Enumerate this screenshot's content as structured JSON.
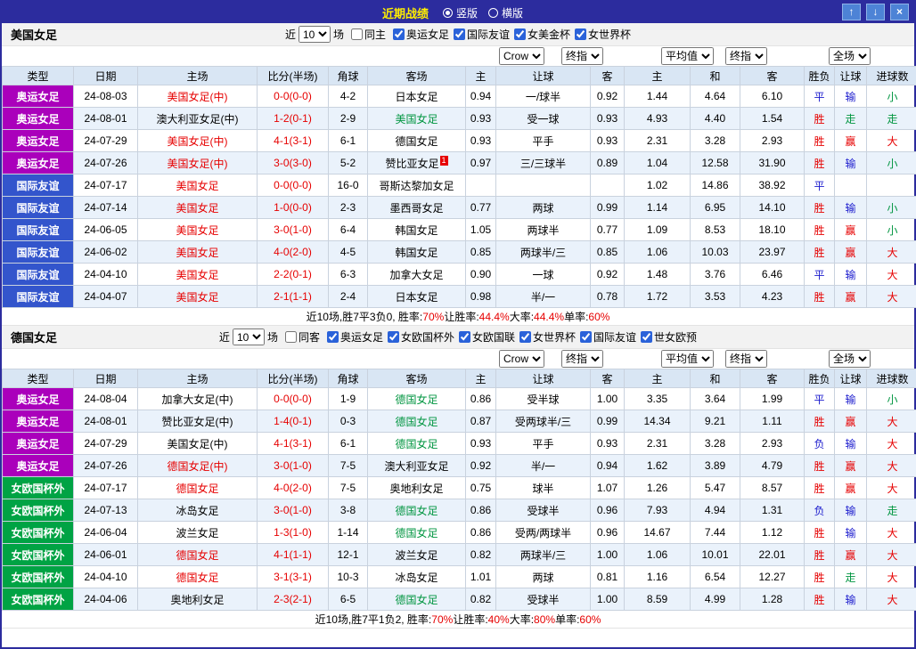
{
  "titlebar": {
    "title": "近期战绩",
    "radios": [
      {
        "label": "竖版",
        "selected": true
      },
      {
        "label": "横版",
        "selected": false
      }
    ],
    "buttons": [
      {
        "name": "scroll-up",
        "glyph": "↑"
      },
      {
        "name": "scroll-down",
        "glyph": "↓"
      },
      {
        "name": "close",
        "glyph": "×"
      }
    ]
  },
  "columns": [
    "类型",
    "日期",
    "主场",
    "比分(半场)",
    "角球",
    "客场",
    "主",
    "让球",
    "客",
    "主",
    "和",
    "客",
    "胜负",
    "让球",
    "进球数"
  ],
  "header_selects": [
    "Crow",
    "终指",
    "平均值",
    "终指",
    "全场"
  ],
  "colors": {
    "topbar": "#2c2c9e",
    "title": "#ffee00",
    "header_bg": "#d9e6f4",
    "alt_row_bg": "#eaf2fb",
    "type_olympic": "#aa00bb",
    "type_friendly": "#3355cc",
    "type_euroq": "#00a344",
    "red": "#e60000",
    "green": "#009540",
    "blue": "#1a1acd"
  },
  "sections": [
    {
      "team": "美国女足",
      "filters": {
        "near": "近",
        "count": "10",
        "games": "场",
        "same": {
          "label": "同主",
          "checked": false
        },
        "leagues": [
          {
            "label": "奥运女足",
            "checked": true
          },
          {
            "label": "国际友谊",
            "checked": true
          },
          {
            "label": "女美金杯",
            "checked": true
          },
          {
            "label": "女世界杯",
            "checked": true
          }
        ]
      },
      "rows": [
        {
          "league": "奥运女足",
          "lc": "olympic",
          "date": "24-08-03",
          "home": "美国女足(中)",
          "homec": "red",
          "score": "0-0(0-0)",
          "corner": "4-2",
          "away": "日本女足",
          "awayc": "black",
          "badge": "",
          "wo": "0.94",
          "line": "一/球半",
          "lo": "0.92",
          "ah": "1.44",
          "ad": "4.64",
          "aa": "6.10",
          "wdl": "平",
          "wdlc": "blue",
          "hr": "输",
          "hrc": "blue",
          "gr": "小",
          "grc": "green"
        },
        {
          "league": "奥运女足",
          "lc": "olympic",
          "date": "24-08-01",
          "home": "澳大利亚女足(中)",
          "homec": "black",
          "score": "1-2(0-1)",
          "corner": "2-9",
          "away": "美国女足",
          "awayc": "green",
          "badge": "",
          "wo": "0.93",
          "line": "受一球",
          "lo": "0.93",
          "ah": "4.93",
          "ad": "4.40",
          "aa": "1.54",
          "wdl": "胜",
          "wdlc": "red",
          "hr": "走",
          "hrc": "green",
          "gr": "走",
          "grc": "green"
        },
        {
          "league": "奥运女足",
          "lc": "olympic",
          "date": "24-07-29",
          "home": "美国女足(中)",
          "homec": "red",
          "score": "4-1(3-1)",
          "corner": "6-1",
          "away": "德国女足",
          "awayc": "black",
          "badge": "",
          "wo": "0.93",
          "line": "平手",
          "lo": "0.93",
          "ah": "2.31",
          "ad": "3.28",
          "aa": "2.93",
          "wdl": "胜",
          "wdlc": "red",
          "hr": "赢",
          "hrc": "red",
          "gr": "大",
          "grc": "red"
        },
        {
          "league": "奥运女足",
          "lc": "olympic",
          "date": "24-07-26",
          "home": "美国女足(中)",
          "homec": "red",
          "score": "3-0(3-0)",
          "corner": "5-2",
          "away": "赞比亚女足",
          "awayc": "black",
          "badge": "1",
          "wo": "0.97",
          "line": "三/三球半",
          "lo": "0.89",
          "ah": "1.04",
          "ad": "12.58",
          "aa": "31.90",
          "wdl": "胜",
          "wdlc": "red",
          "hr": "输",
          "hrc": "blue",
          "gr": "小",
          "grc": "green"
        },
        {
          "league": "国际友谊",
          "lc": "friendly",
          "date": "24-07-17",
          "home": "美国女足",
          "homec": "red",
          "score": "0-0(0-0)",
          "corner": "16-0",
          "away": "哥斯达黎加女足",
          "awayc": "black",
          "badge": "",
          "wo": "",
          "line": "",
          "lo": "",
          "ah": "1.02",
          "ad": "14.86",
          "aa": "38.92",
          "wdl": "平",
          "wdlc": "blue",
          "hr": "",
          "hrc": "black",
          "gr": "",
          "grc": "black"
        },
        {
          "league": "国际友谊",
          "lc": "friendly",
          "date": "24-07-14",
          "home": "美国女足",
          "homec": "red",
          "score": "1-0(0-0)",
          "corner": "2-3",
          "away": "墨西哥女足",
          "awayc": "black",
          "badge": "",
          "wo": "0.77",
          "line": "两球",
          "lo": "0.99",
          "ah": "1.14",
          "ad": "6.95",
          "aa": "14.10",
          "wdl": "胜",
          "wdlc": "red",
          "hr": "输",
          "hrc": "blue",
          "gr": "小",
          "grc": "green"
        },
        {
          "league": "国际友谊",
          "lc": "friendly",
          "date": "24-06-05",
          "home": "美国女足",
          "homec": "red",
          "score": "3-0(1-0)",
          "corner": "6-4",
          "away": "韩国女足",
          "awayc": "black",
          "badge": "",
          "wo": "1.05",
          "line": "两球半",
          "lo": "0.77",
          "ah": "1.09",
          "ad": "8.53",
          "aa": "18.10",
          "wdl": "胜",
          "wdlc": "red",
          "hr": "赢",
          "hrc": "red",
          "gr": "小",
          "grc": "green"
        },
        {
          "league": "国际友谊",
          "lc": "friendly",
          "date": "24-06-02",
          "home": "美国女足",
          "homec": "red",
          "score": "4-0(2-0)",
          "corner": "4-5",
          "away": "韩国女足",
          "awayc": "black",
          "badge": "",
          "wo": "0.85",
          "line": "两球半/三",
          "lo": "0.85",
          "ah": "1.06",
          "ad": "10.03",
          "aa": "23.97",
          "wdl": "胜",
          "wdlc": "red",
          "hr": "赢",
          "hrc": "red",
          "gr": "大",
          "grc": "red"
        },
        {
          "league": "国际友谊",
          "lc": "friendly",
          "date": "24-04-10",
          "home": "美国女足",
          "homec": "red",
          "score": "2-2(0-1)",
          "corner": "6-3",
          "away": "加拿大女足",
          "awayc": "black",
          "badge": "",
          "wo": "0.90",
          "line": "一球",
          "lo": "0.92",
          "ah": "1.48",
          "ad": "3.76",
          "aa": "6.46",
          "wdl": "平",
          "wdlc": "blue",
          "hr": "输",
          "hrc": "blue",
          "gr": "大",
          "grc": "red"
        },
        {
          "league": "国际友谊",
          "lc": "friendly",
          "date": "24-04-07",
          "home": "美国女足",
          "homec": "red",
          "score": "2-1(1-1)",
          "corner": "2-4",
          "away": "日本女足",
          "awayc": "black",
          "badge": "",
          "wo": "0.98",
          "line": "半/一",
          "lo": "0.78",
          "ah": "1.72",
          "ad": "3.53",
          "aa": "4.23",
          "wdl": "胜",
          "wdlc": "red",
          "hr": "赢",
          "hrc": "red",
          "gr": "大",
          "grc": "red"
        }
      ],
      "summary": [
        {
          "t": "近10场,胜7平3负0, 胜率:",
          "c": "black"
        },
        {
          "t": "70%",
          "c": "red"
        },
        {
          "t": " 让胜率:",
          "c": "black"
        },
        {
          "t": "44.4%",
          "c": "red"
        },
        {
          "t": " 大率:",
          "c": "black"
        },
        {
          "t": "44.4%",
          "c": "red"
        },
        {
          "t": " 单率:",
          "c": "black"
        },
        {
          "t": "60%",
          "c": "red"
        }
      ]
    },
    {
      "team": "德国女足",
      "filters": {
        "near": "近",
        "count": "10",
        "games": "场",
        "same": {
          "label": "同客",
          "checked": false
        },
        "leagues": [
          {
            "label": "奥运女足",
            "checked": true
          },
          {
            "label": "女欧国杯外",
            "checked": true
          },
          {
            "label": "女欧国联",
            "checked": true
          },
          {
            "label": "女世界杯",
            "checked": true
          },
          {
            "label": "国际友谊",
            "checked": true
          },
          {
            "label": "世女欧预",
            "checked": true
          }
        ]
      },
      "rows": [
        {
          "league": "奥运女足",
          "lc": "olympic",
          "date": "24-08-04",
          "home": "加拿大女足(中)",
          "homec": "black",
          "score": "0-0(0-0)",
          "corner": "1-9",
          "away": "德国女足",
          "awayc": "green",
          "badge": "",
          "wo": "0.86",
          "line": "受半球",
          "lo": "1.00",
          "ah": "3.35",
          "ad": "3.64",
          "aa": "1.99",
          "wdl": "平",
          "wdlc": "blue",
          "hr": "输",
          "hrc": "blue",
          "gr": "小",
          "grc": "green"
        },
        {
          "league": "奥运女足",
          "lc": "olympic",
          "date": "24-08-01",
          "home": "赞比亚女足(中)",
          "homec": "black",
          "score": "1-4(0-1)",
          "corner": "0-3",
          "away": "德国女足",
          "awayc": "green",
          "badge": "",
          "wo": "0.87",
          "line": "受两球半/三",
          "lo": "0.99",
          "ah": "14.34",
          "ad": "9.21",
          "aa": "1.11",
          "wdl": "胜",
          "wdlc": "red",
          "hr": "赢",
          "hrc": "red",
          "gr": "大",
          "grc": "red"
        },
        {
          "league": "奥运女足",
          "lc": "olympic",
          "date": "24-07-29",
          "home": "美国女足(中)",
          "homec": "black",
          "score": "4-1(3-1)",
          "corner": "6-1",
          "away": "德国女足",
          "awayc": "green",
          "badge": "",
          "wo": "0.93",
          "line": "平手",
          "lo": "0.93",
          "ah": "2.31",
          "ad": "3.28",
          "aa": "2.93",
          "wdl": "负",
          "wdlc": "blue",
          "hr": "输",
          "hrc": "blue",
          "gr": "大",
          "grc": "red"
        },
        {
          "league": "奥运女足",
          "lc": "olympic",
          "date": "24-07-26",
          "home": "德国女足(中)",
          "homec": "red",
          "score": "3-0(1-0)",
          "corner": "7-5",
          "away": "澳大利亚女足",
          "awayc": "black",
          "badge": "",
          "wo": "0.92",
          "line": "半/一",
          "lo": "0.94",
          "ah": "1.62",
          "ad": "3.89",
          "aa": "4.79",
          "wdl": "胜",
          "wdlc": "red",
          "hr": "赢",
          "hrc": "red",
          "gr": "大",
          "grc": "red"
        },
        {
          "league": "女欧国杯外",
          "lc": "euroq",
          "date": "24-07-17",
          "home": "德国女足",
          "homec": "red",
          "score": "4-0(2-0)",
          "corner": "7-5",
          "away": "奥地利女足",
          "awayc": "black",
          "badge": "",
          "wo": "0.75",
          "line": "球半",
          "lo": "1.07",
          "ah": "1.26",
          "ad": "5.47",
          "aa": "8.57",
          "wdl": "胜",
          "wdlc": "red",
          "hr": "赢",
          "hrc": "red",
          "gr": "大",
          "grc": "red"
        },
        {
          "league": "女欧国杯外",
          "lc": "euroq",
          "date": "24-07-13",
          "home": "冰岛女足",
          "homec": "black",
          "score": "3-0(1-0)",
          "corner": "3-8",
          "away": "德国女足",
          "awayc": "green",
          "badge": "",
          "wo": "0.86",
          "line": "受球半",
          "lo": "0.96",
          "ah": "7.93",
          "ad": "4.94",
          "aa": "1.31",
          "wdl": "负",
          "wdlc": "blue",
          "hr": "输",
          "hrc": "blue",
          "gr": "走",
          "grc": "green"
        },
        {
          "league": "女欧国杯外",
          "lc": "euroq",
          "date": "24-06-04",
          "home": "波兰女足",
          "homec": "black",
          "score": "1-3(1-0)",
          "corner": "1-14",
          "away": "德国女足",
          "awayc": "green",
          "badge": "",
          "wo": "0.86",
          "line": "受两/两球半",
          "lo": "0.96",
          "ah": "14.67",
          "ad": "7.44",
          "aa": "1.12",
          "wdl": "胜",
          "wdlc": "red",
          "hr": "输",
          "hrc": "blue",
          "gr": "大",
          "grc": "red"
        },
        {
          "league": "女欧国杯外",
          "lc": "euroq",
          "date": "24-06-01",
          "home": "德国女足",
          "homec": "red",
          "score": "4-1(1-1)",
          "corner": "12-1",
          "away": "波兰女足",
          "awayc": "black",
          "badge": "",
          "wo": "0.82",
          "line": "两球半/三",
          "lo": "1.00",
          "ah": "1.06",
          "ad": "10.01",
          "aa": "22.01",
          "wdl": "胜",
          "wdlc": "red",
          "hr": "赢",
          "hrc": "red",
          "gr": "大",
          "grc": "red"
        },
        {
          "league": "女欧国杯外",
          "lc": "euroq",
          "date": "24-04-10",
          "home": "德国女足",
          "homec": "red",
          "score": "3-1(3-1)",
          "corner": "10-3",
          "away": "冰岛女足",
          "awayc": "black",
          "badge": "",
          "wo": "1.01",
          "line": "两球",
          "lo": "0.81",
          "ah": "1.16",
          "ad": "6.54",
          "aa": "12.27",
          "wdl": "胜",
          "wdlc": "red",
          "hr": "走",
          "hrc": "green",
          "gr": "大",
          "grc": "red"
        },
        {
          "league": "女欧国杯外",
          "lc": "euroq",
          "date": "24-04-06",
          "home": "奥地利女足",
          "homec": "black",
          "score": "2-3(2-1)",
          "corner": "6-5",
          "away": "德国女足",
          "awayc": "green",
          "badge": "",
          "wo": "0.82",
          "line": "受球半",
          "lo": "1.00",
          "ah": "8.59",
          "ad": "4.99",
          "aa": "1.28",
          "wdl": "胜",
          "wdlc": "red",
          "hr": "输",
          "hrc": "blue",
          "gr": "大",
          "grc": "red"
        }
      ],
      "summary": [
        {
          "t": "近10场,胜7平1负2, 胜率:",
          "c": "black"
        },
        {
          "t": "70%",
          "c": "red"
        },
        {
          "t": " 让胜率:",
          "c": "black"
        },
        {
          "t": "40%",
          "c": "red"
        },
        {
          "t": " 大率:",
          "c": "black"
        },
        {
          "t": "80%",
          "c": "red"
        },
        {
          "t": " 单率:",
          "c": "black"
        },
        {
          "t": "60%",
          "c": "red"
        }
      ]
    }
  ]
}
